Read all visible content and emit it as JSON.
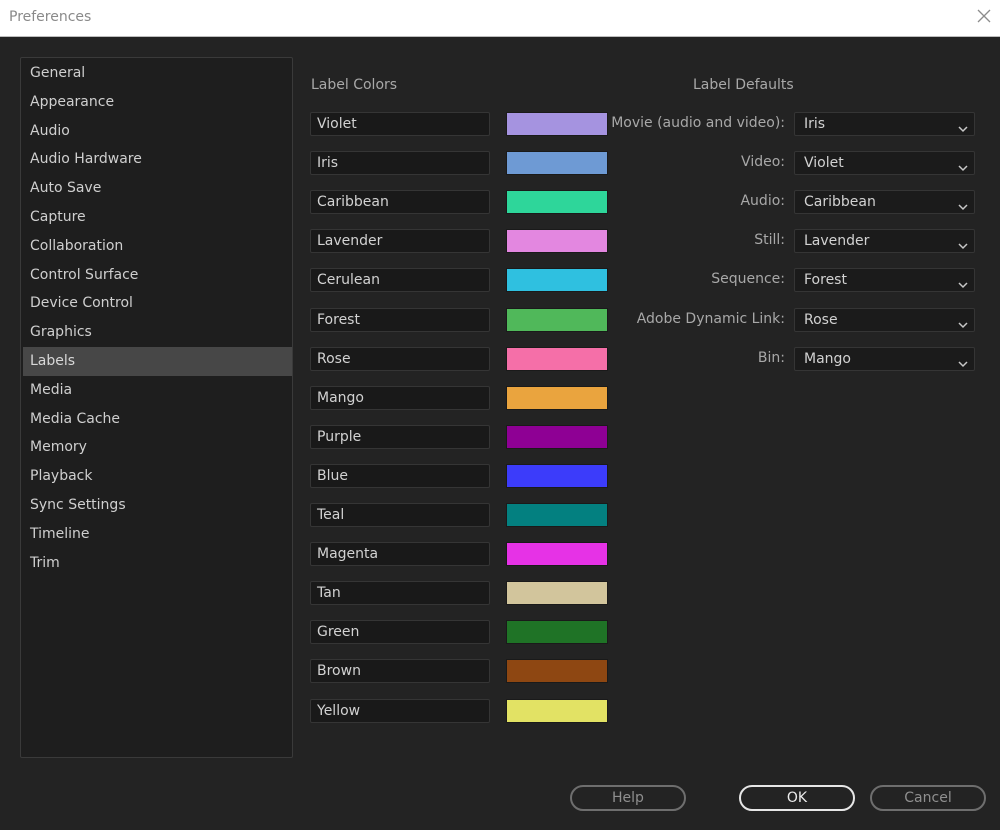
{
  "window": {
    "title": "Preferences",
    "close_icon": "close-x-icon"
  },
  "sidebar": {
    "items": [
      {
        "label": "General"
      },
      {
        "label": "Appearance"
      },
      {
        "label": "Audio"
      },
      {
        "label": "Audio Hardware"
      },
      {
        "label": "Auto Save"
      },
      {
        "label": "Capture"
      },
      {
        "label": "Collaboration"
      },
      {
        "label": "Control Surface"
      },
      {
        "label": "Device Control"
      },
      {
        "label": "Graphics"
      },
      {
        "label": "Labels",
        "selected": true
      },
      {
        "label": "Media"
      },
      {
        "label": "Media Cache"
      },
      {
        "label": "Memory"
      },
      {
        "label": "Playback"
      },
      {
        "label": "Sync Settings"
      },
      {
        "label": "Timeline"
      },
      {
        "label": "Trim"
      }
    ]
  },
  "label_colors": {
    "title": "Label Colors",
    "items": [
      {
        "name": "Violet",
        "color": "#a593e0"
      },
      {
        "name": "Iris",
        "color": "#6e9ad4"
      },
      {
        "name": "Caribbean",
        "color": "#2ed69a"
      },
      {
        "name": "Lavender",
        "color": "#e387e0"
      },
      {
        "name": "Cerulean",
        "color": "#2fc0e0"
      },
      {
        "name": "Forest",
        "color": "#50b85a"
      },
      {
        "name": "Rose",
        "color": "#f56fa8"
      },
      {
        "name": "Mango",
        "color": "#eaa43e"
      },
      {
        "name": "Purple",
        "color": "#8e0094"
      },
      {
        "name": "Blue",
        "color": "#3c3cfa"
      },
      {
        "name": "Teal",
        "color": "#038080"
      },
      {
        "name": "Magenta",
        "color": "#e632e6"
      },
      {
        "name": "Tan",
        "color": "#d2c59c"
      },
      {
        "name": "Green",
        "color": "#1f7326"
      },
      {
        "name": "Brown",
        "color": "#8e4712"
      },
      {
        "name": "Yellow",
        "color": "#e2e264"
      }
    ]
  },
  "label_defaults": {
    "title": "Label Defaults",
    "items": [
      {
        "label": "Movie (audio and video):",
        "value": "Iris"
      },
      {
        "label": "Video:",
        "value": "Violet"
      },
      {
        "label": "Audio:",
        "value": "Caribbean"
      },
      {
        "label": "Still:",
        "value": "Lavender"
      },
      {
        "label": "Sequence:",
        "value": "Forest"
      },
      {
        "label": "Adobe Dynamic Link:",
        "value": "Rose"
      },
      {
        "label": "Bin:",
        "value": "Mango"
      }
    ]
  },
  "buttons": {
    "help": "Help",
    "ok": "OK",
    "cancel": "Cancel"
  }
}
